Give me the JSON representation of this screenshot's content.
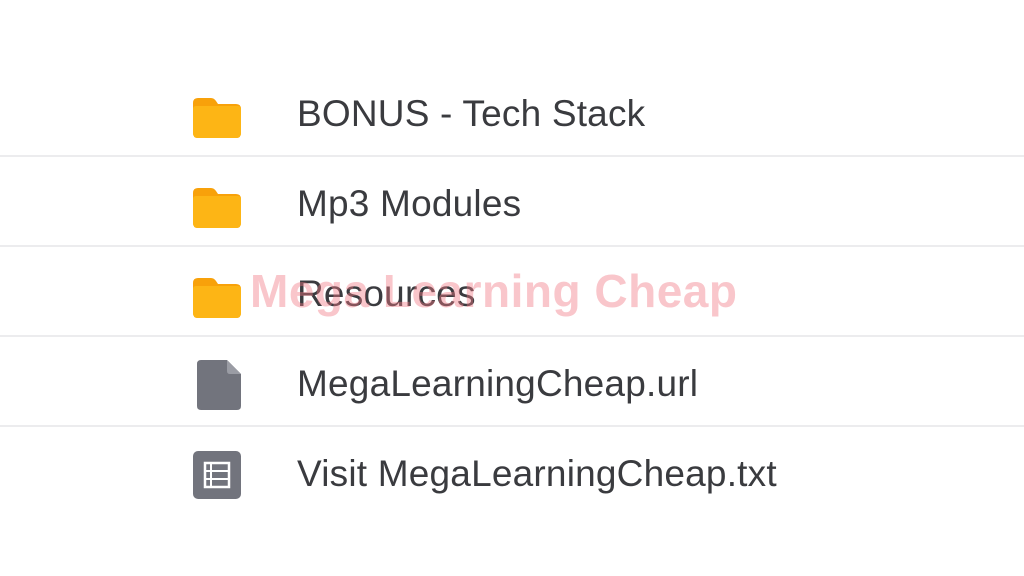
{
  "files": [
    {
      "name": "BONUS - Tech Stack",
      "icon": "folder-icon"
    },
    {
      "name": "Mp3 Modules",
      "icon": "folder-icon"
    },
    {
      "name": "Resources",
      "icon": "folder-icon"
    },
    {
      "name": "MegaLearningCheap.url",
      "icon": "file-icon"
    },
    {
      "name": "Visit MegaLearningCheap.txt",
      "icon": "text-file-icon"
    }
  ],
  "watermark": "Mega Learning Cheap",
  "colors": {
    "folder": "#fdb515",
    "folder_dark": "#f8a10a",
    "file": "#72747d",
    "text": "#3a3b3f",
    "divider": "#ececee",
    "watermark": "#f07882"
  }
}
